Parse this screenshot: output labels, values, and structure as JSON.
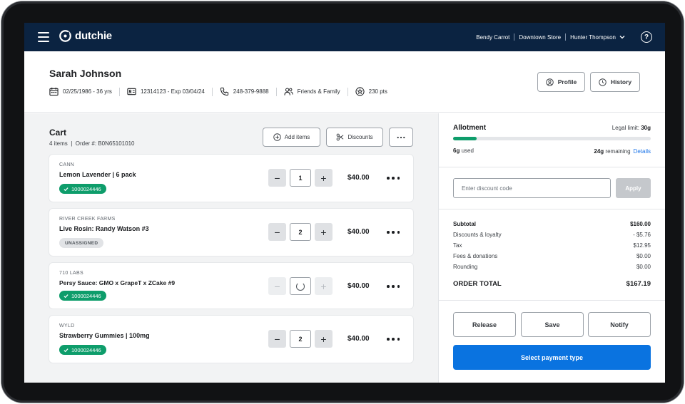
{
  "nav": {
    "brand": "dutchie",
    "register": "Bendy Carrot",
    "location": "Downtown Store",
    "user": "Hunter Thompson",
    "help": "?"
  },
  "customer": {
    "name": "Sarah Johnson",
    "dob": "02/25/1986 - 36 yrs",
    "id": "12314123 - Exp 03/04/24",
    "phone": "248-379-9888",
    "group": "Friends & Family",
    "points": "230 pts",
    "profile_label": "Profile",
    "history_label": "History"
  },
  "cart": {
    "title": "Cart",
    "summary": "4 items  |  Order #: B0N65101010",
    "add_items_label": "Add items",
    "discounts_label": "Discounts",
    "items": [
      {
        "brand": "CANN",
        "name": "Lemon Lavender | 6 pack",
        "tag": "1000024446",
        "tag_type": "assigned",
        "qty": "1",
        "price": "$40.00",
        "loading": false
      },
      {
        "brand": "RIVER CREEK FARMS",
        "name": "Live Rosin: Randy Watson #3",
        "tag": "UNASSIGNED",
        "tag_type": "unassigned",
        "qty": "2",
        "price": "$40.00",
        "loading": false
      },
      {
        "brand": "710 LABS",
        "name": "Persy Sauce: GMO x GrapeT x ZCake #9",
        "tag": "1000024446",
        "tag_type": "assigned",
        "qty": "",
        "price": "$40.00",
        "loading": true
      },
      {
        "brand": "WYLD",
        "name": "Strawberry Gummies | 100mg",
        "tag": "1000024446",
        "tag_type": "assigned",
        "qty": "2",
        "price": "$40.00",
        "loading": false
      }
    ]
  },
  "allotment": {
    "title": "Allotment",
    "legal_prefix": "Legal limit: ",
    "legal_value": "30g",
    "used_value": "6g",
    "used_suffix": " used",
    "used_fraction": 0.2,
    "remaining_value": "24g",
    "remaining_suffix": " remaining",
    "details_label": "Details"
  },
  "discount": {
    "placeholder": "Enter discount code",
    "apply_label": "Apply"
  },
  "summary": {
    "rows": [
      {
        "label": "Subtotal",
        "value": "$160.00"
      },
      {
        "label": "Discounts & loyalty",
        "value": "- $5.76"
      },
      {
        "label": "Tax",
        "value": "$12.95"
      },
      {
        "label": "Fees & donations",
        "value": "$0.00"
      },
      {
        "label": "Rounding",
        "value": "$0.00"
      }
    ],
    "total_label": "ORDER TOTAL",
    "total_value": "$167.19"
  },
  "actions": {
    "release_label": "Release",
    "save_label": "Save",
    "notify_label": "Notify",
    "pay_label": "Select payment type"
  },
  "colors": {
    "nav_bg": "#0b2341",
    "accent_green": "#0e9d6b",
    "primary_blue": "#0a73e0"
  }
}
